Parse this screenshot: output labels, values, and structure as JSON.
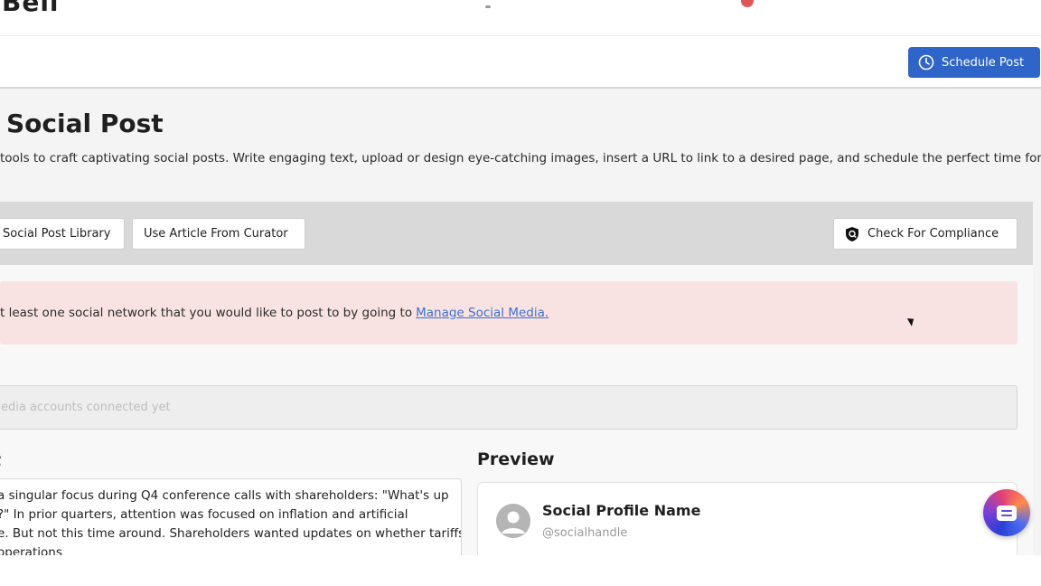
{
  "header": {
    "logo_text": "Bell"
  },
  "actions": {
    "schedule_label": "Schedule Post"
  },
  "page": {
    "title": "Social Post",
    "description": "tools to craft captivating social posts. Write engaging text, upload or design eye-catching images, insert a URL to link to a desired page, and schedule the perfect time for"
  },
  "toolbar": {
    "library_label": "Social Post Library",
    "curator_label": "Use Article From Curator",
    "compliance_label": "Check For Compliance"
  },
  "alert": {
    "text": "t least one social network that you would like to post to by going to",
    "link_text": "Manage Social Media."
  },
  "accounts": {
    "placeholder": "edia accounts connected yet"
  },
  "post": {
    "heading": "t",
    "lines": [
      "a singular focus during Q4 conference calls with shareholders: \"What's up",
      "?\"  In prior quarters, attention was focused on inflation and artificial",
      "e. But not this time around. Shareholders wanted updates on whether tariffs",
      "operations"
    ]
  },
  "preview": {
    "heading": "Preview",
    "profile_name": "Social Profile Name",
    "profile_handle": "@socialhandle"
  },
  "colors": {
    "primary": "#2f64c8",
    "alert_bg": "#f8e3e2",
    "link": "#3d6fd1"
  }
}
